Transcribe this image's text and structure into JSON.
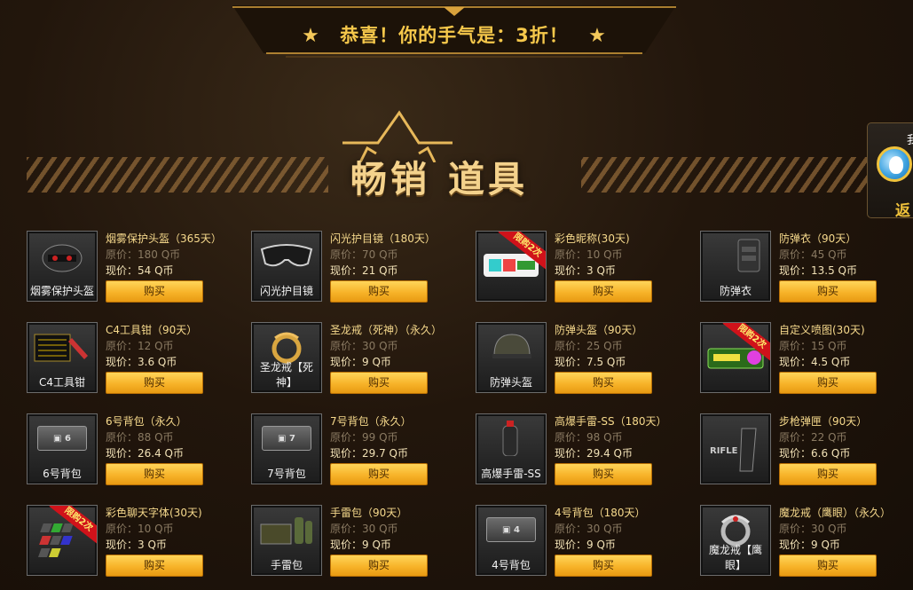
{
  "banner": {
    "text": "恭喜！你的手气是：3折！",
    "star_icon": "★"
  },
  "section": {
    "title_word1": "畅销",
    "title_word2": "道具"
  },
  "side_widget": {
    "top_text": "我",
    "bottom_text": "返"
  },
  "labels": {
    "orig_prefix": "原价：",
    "now_prefix": "现价：",
    "buy": "购买",
    "ribbon": "限购2次"
  },
  "colors": {
    "accent": "#f6c84b",
    "buy_button": "#f7b329",
    "ribbon": "#d0121a"
  },
  "items": [
    {
      "name": "烟雾保护头盔（365天）",
      "orig": "原价：180 Q币",
      "now": "现价：54 Q币",
      "thumb_label": "烟雾保护头盔",
      "art": "helmet-icon",
      "ribbon": false
    },
    {
      "name": "闪光护目镜（180天）",
      "orig": "原价：70 Q币",
      "now": "现价：21 Q币",
      "thumb_label": "闪光护目镜",
      "art": "goggles-icon",
      "ribbon": false
    },
    {
      "name": "彩色昵称(30天)",
      "orig": "原价：10 Q币",
      "now": "现价：3 Q币",
      "thumb_label": "",
      "art": "color-nickname-icon",
      "ribbon": true
    },
    {
      "name": "防弹衣（90天）",
      "orig": "原价：45 Q币",
      "now": "现价：13.5 Q币",
      "thumb_label": "防弹衣",
      "art": "vest-icon",
      "ribbon": false
    },
    {
      "name": "C4工具钳（90天）",
      "orig": "原价：12 Q币",
      "now": "现价：3.6 Q币",
      "thumb_label": "C4工具钳",
      "art": "c4-tool-icon",
      "ribbon": false
    },
    {
      "name": "圣龙戒（死神）（永久）",
      "orig": "原价：30 Q币",
      "now": "现价：9 Q币",
      "thumb_label": "圣龙戒【死神】",
      "art": "dragon-ring-icon",
      "ribbon": false
    },
    {
      "name": "防弹头盔（90天）",
      "orig": "原价：25 Q币",
      "now": "现价：7.5 Q币",
      "thumb_label": "防弹头盔",
      "art": "armor-helmet-icon",
      "ribbon": false
    },
    {
      "name": "自定义喷图(30天)",
      "orig": "原价：15 Q币",
      "now": "现价：4.5 Q币",
      "thumb_label": "",
      "art": "spray-icon",
      "ribbon": true
    },
    {
      "name": "6号背包（永久）",
      "orig": "原价：88 Q币",
      "now": "现价：26.4 Q币",
      "thumb_label": "6号背包",
      "art": "backpack-6-icon",
      "ribbon": false
    },
    {
      "name": "7号背包（永久）",
      "orig": "原价：99 Q币",
      "now": "现价：29.7 Q币",
      "thumb_label": "7号背包",
      "art": "backpack-7-icon",
      "ribbon": false
    },
    {
      "name": "高爆手雷-SS（180天）",
      "orig": "原价：98 Q币",
      "now": "现价：29.4 Q币",
      "thumb_label": "高爆手雷-SS",
      "art": "grenade-icon",
      "ribbon": false
    },
    {
      "name": "步枪弹匣（90天）",
      "orig": "原价：22 Q币",
      "now": "现价：6.6 Q币",
      "thumb_label": "",
      "art": "rifle-mag-icon",
      "ribbon": false
    },
    {
      "name": "彩色聊天字体(30天)",
      "orig": "原价：10 Q币",
      "now": "现价：3 Q币",
      "thumb_label": "",
      "art": "chat-font-icon",
      "ribbon": true
    },
    {
      "name": "手雷包（90天）",
      "orig": "原价：30 Q币",
      "now": "现价：9 Q币",
      "thumb_label": "手雷包",
      "art": "grenade-pack-icon",
      "ribbon": false
    },
    {
      "name": "4号背包（180天）",
      "orig": "原价：30 Q币",
      "now": "现价：9 Q币",
      "thumb_label": "4号背包",
      "art": "backpack-4-icon",
      "ribbon": false
    },
    {
      "name": "魔龙戒（鹰眼）（永久）",
      "orig": "原价：30 Q币",
      "now": "现价：9 Q币",
      "thumb_label": "魔龙戒【鹰眼】",
      "art": "demon-ring-icon",
      "ribbon": false
    }
  ]
}
